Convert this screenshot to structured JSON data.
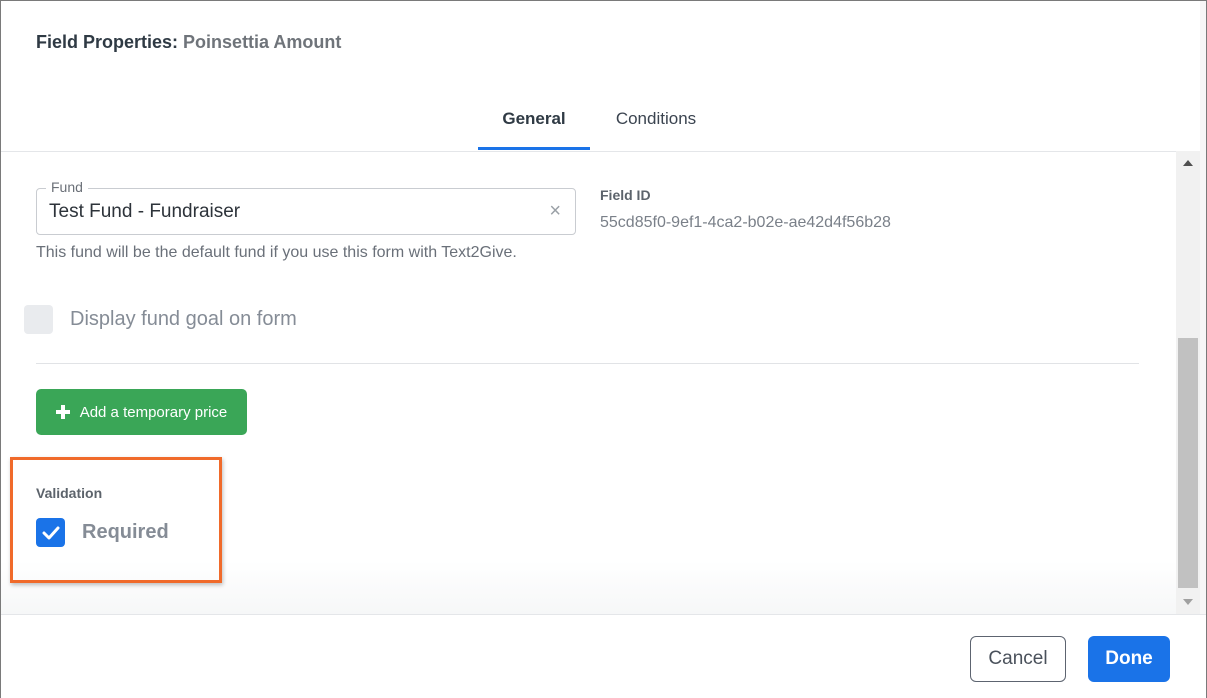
{
  "dialog": {
    "title_prefix": "Field Properties:",
    "title_field": "Poinsettia Amount"
  },
  "tabs": [
    {
      "label": "General",
      "active": true
    },
    {
      "label": "Conditions",
      "active": false
    }
  ],
  "fund": {
    "legend": "Fund",
    "value": "Test Fund - Fundraiser",
    "clear_icon": "×",
    "help_text": "This fund will be the default fund if you use this form with Text2Give."
  },
  "field_id": {
    "label": "Field ID",
    "value": "55cd85f0-9ef1-4ca2-b02e-ae42d4f56b28"
  },
  "display_goal": {
    "label": "Display fund goal on form",
    "checked": false
  },
  "temporary_price_button": {
    "label": "Add a temporary price",
    "icon": "plus-icon"
  },
  "validation": {
    "label": "Validation",
    "required_label": "Required",
    "required_checked": true
  },
  "footer": {
    "cancel_label": "Cancel",
    "done_label": "Done"
  },
  "colors": {
    "accent": "#1a73e8",
    "success": "#3aa657",
    "highlight": "#f06a2a"
  }
}
